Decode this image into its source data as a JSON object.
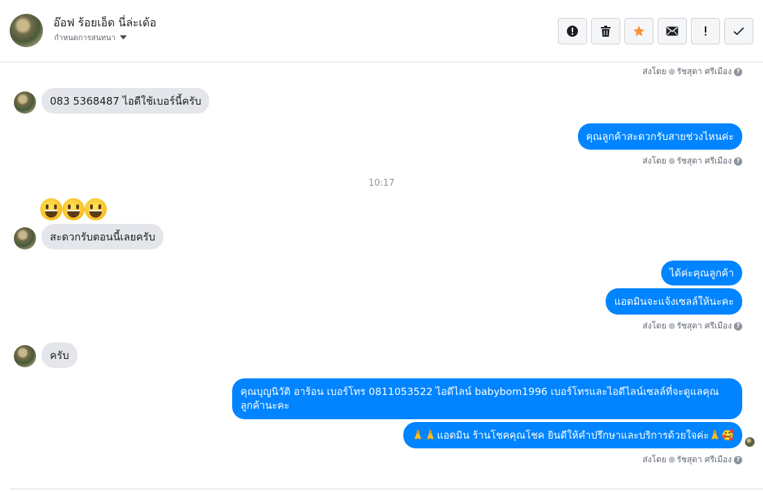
{
  "header": {
    "contact_name": "อ๊อฟ ร้อยเอ็ด นี่ล่ะเด้อ",
    "settings_label": "กำหนดการสนทนา",
    "toolbar": [
      {
        "name": "report-spam-button",
        "icon": "alert-circle-icon"
      },
      {
        "name": "delete-button",
        "icon": "trash-icon"
      },
      {
        "name": "star-button",
        "icon": "star-icon"
      },
      {
        "name": "mark-unread-button",
        "icon": "envelope-icon"
      },
      {
        "name": "follow-up-button",
        "icon": "exclamation-icon"
      },
      {
        "name": "mark-done-button",
        "icon": "checkmark-icon"
      }
    ],
    "star_color": "#f7923b"
  },
  "thread": {
    "sent_by_prefix": "ส่งโดย",
    "sent_by_name": "รัชสุดา ศรีเมือง",
    "time_separator": "10:17",
    "messages": {
      "m1": "083 5368487  ไอดีใช้เบอร์นี้ครับ",
      "m2": "คุณลูกค้าสะดวกรับสายช่วงไหนค่ะ",
      "m3": "สะดวกรับตอนนี้เลยครับ",
      "m4": "ได้ค่ะคุณลูกค้า",
      "m5": "แอดมินจะแจ้งเซลล์ให้นะคะ",
      "m6": "ครับ",
      "m7": "คุณบุญนิวัติ  อาร้อน        เบอร์โทร 0811053522  ไอดีไลน์ babybom1996  เบอร์โทรและไอดีไลน์เซลล์ที่จะดูแลคุณลูกค้านะคะ",
      "m8_text": "แอดมิน ร้านโชคคุณโชค ยินดีให้คำปรึกษาและบริการด้วยใจค่ะ",
      "m8_prefix": "🙏🙏",
      "m8_suffix": "🙏🥰"
    },
    "emoji_reaction": "😀😀😀"
  },
  "colors": {
    "outgoing_bubble": "#0084ff",
    "incoming_bubble": "#e4e6eb"
  }
}
